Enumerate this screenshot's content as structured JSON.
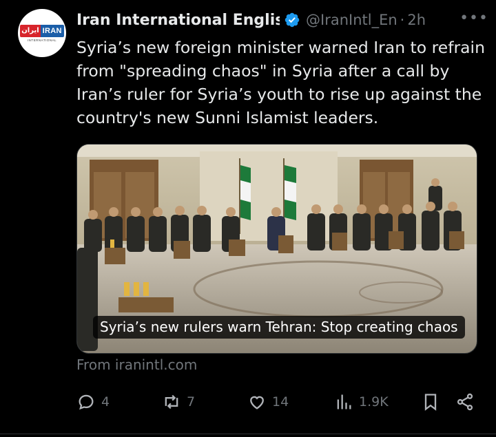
{
  "account": {
    "name": "Iran International English",
    "handle": "@IranIntl_En",
    "time": "2h",
    "logo_ar": "ایران",
    "logo_en": "IRAN",
    "logo_sub": "INTERNATIONAL"
  },
  "tweet": {
    "text": "Syria’s new foreign minister warned Iran to refrain from \"spreading chaos\" in Syria after a call by Iran’s ruler for Syria’s youth to rise up against the country's new Sunni Islamist leaders."
  },
  "card": {
    "caption": "Syria’s new rulers warn Tehran: Stop creating chaos",
    "source": "From iranintl.com"
  },
  "actions": {
    "replies": "4",
    "reposts": "7",
    "likes": "14",
    "views": "1.9K"
  },
  "colors": {
    "background": "#000000",
    "text": "#e7e9ea",
    "muted": "#71767b",
    "verified": "#1d9bf0"
  }
}
